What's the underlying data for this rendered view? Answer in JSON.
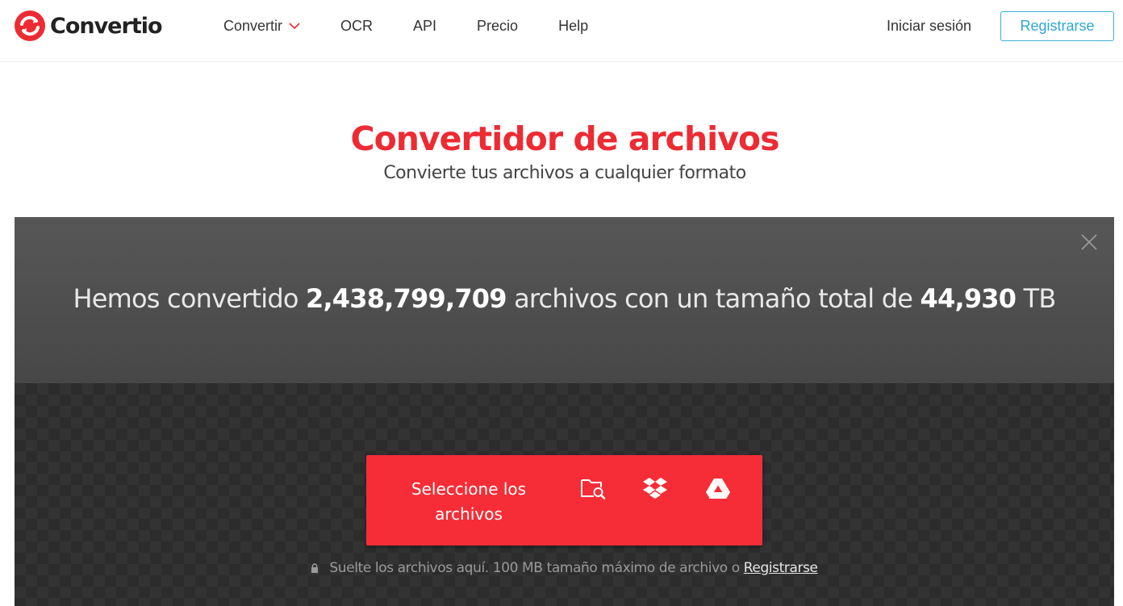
{
  "header": {
    "logo_text": "Convertio",
    "nav": [
      {
        "label": "Convertir",
        "has_dropdown": true
      },
      {
        "label": "OCR"
      },
      {
        "label": "API"
      },
      {
        "label": "Precio"
      },
      {
        "label": "Help"
      }
    ],
    "login_label": "Iniciar sesión",
    "register_label": "Registrarse"
  },
  "hero": {
    "title": "Convertidor de archivos",
    "subtitle": "Convierte tus archivos a cualquier formato"
  },
  "stats": {
    "prefix": "Hemos convertido",
    "files_count": "2,438,799,709",
    "middle": "archivos con un tamaño total de",
    "total_size": "44,930",
    "unit": "TB"
  },
  "uploader": {
    "select_label_line1": "Seleccione los",
    "select_label_line2": "archivos",
    "sources": [
      {
        "icon": "folder-search-icon"
      },
      {
        "icon": "dropbox-icon"
      },
      {
        "icon": "google-drive-icon"
      }
    ],
    "hint_text": "Suelte los archivos aquí. 100 MB tamaño máximo de archivo o",
    "hint_link": "Registrarse"
  },
  "colors": {
    "brand_red": "#f62d36",
    "title_red": "#ed2b33",
    "accent_blue": "#2ea7d4"
  }
}
